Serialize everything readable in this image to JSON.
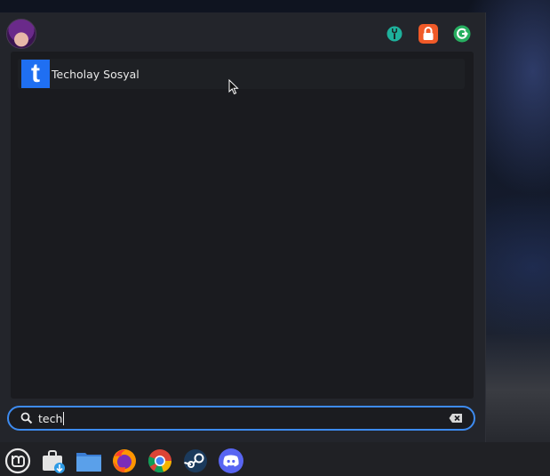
{
  "results": [
    {
      "label": "Techolay Sosyal",
      "icon": "techolay-t-icon",
      "glyph": "t",
      "icon_color": "#1f6ff2"
    }
  ],
  "search": {
    "value": "tech"
  },
  "system_buttons": [
    "settings-icon",
    "lock-screen-icon",
    "logout-icon"
  ],
  "taskbar": [
    "mint-menu-icon",
    "software-manager-icon",
    "files-icon",
    "firefox-icon",
    "chrome-icon",
    "steam-icon",
    "discord-icon"
  ],
  "colors": {
    "accent": "#3d8bf0",
    "settings": "#1eb19c",
    "lock": "#f05a28",
    "logout": "#27ae60"
  }
}
